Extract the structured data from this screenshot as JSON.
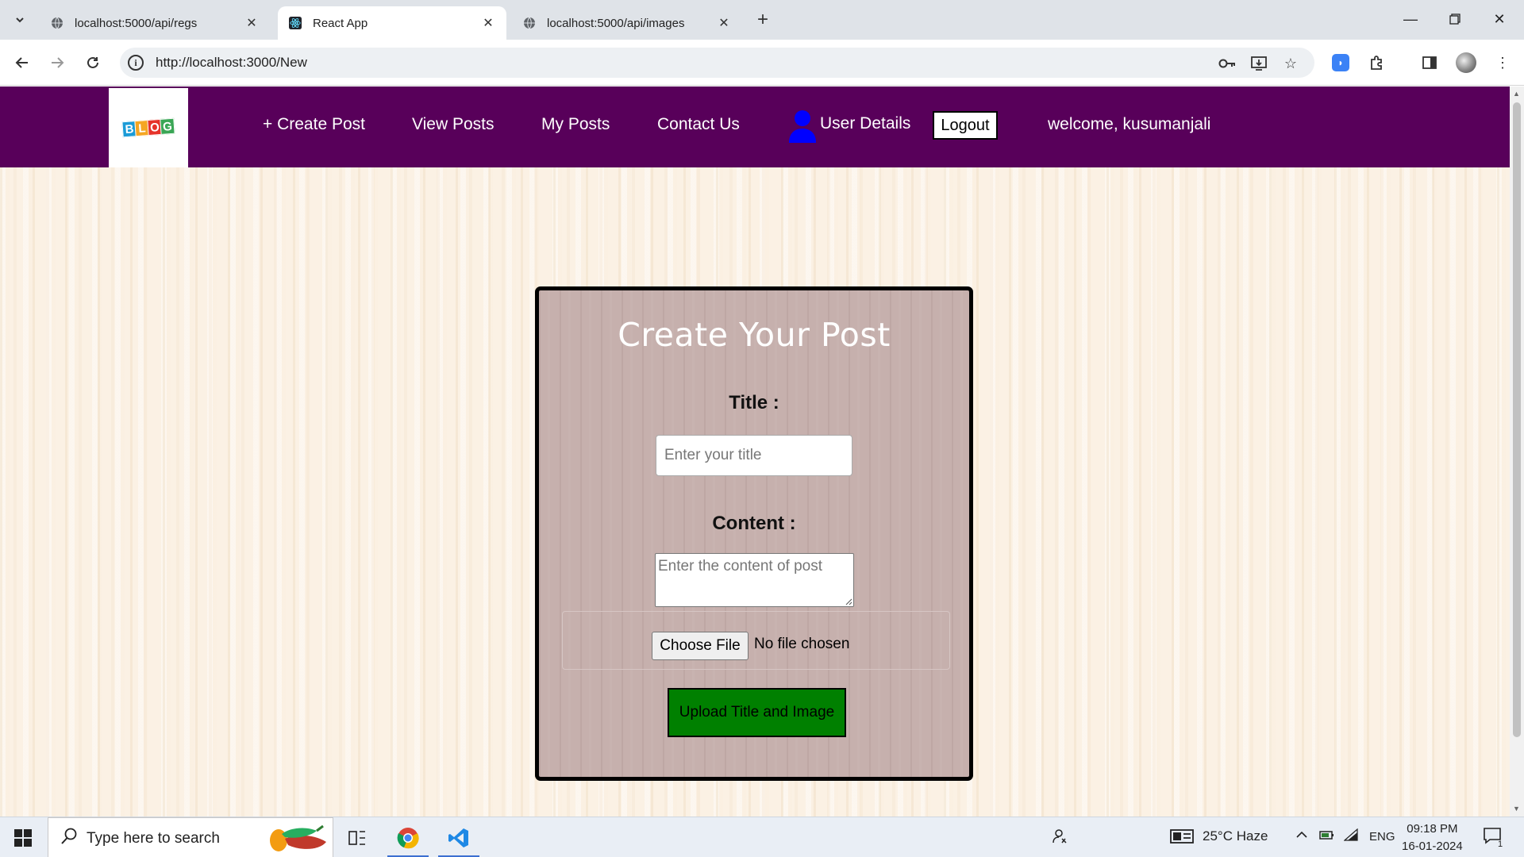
{
  "browser": {
    "tabs": [
      {
        "title": "localhost:5000/api/regs",
        "active": false
      },
      {
        "title": "React App",
        "active": true
      },
      {
        "title": "localhost:5000/api/images",
        "active": false
      }
    ],
    "new_tab_label": "+",
    "url": "http://localhost:3000/New"
  },
  "navbar": {
    "logo_letters": [
      "B",
      "L",
      "O",
      "G"
    ],
    "logo_colors": [
      "#1a9bd7",
      "#f5a623",
      "#e6332a",
      "#3aa655"
    ],
    "background": "#58005a",
    "links": {
      "create_post": "+ Create Post",
      "view_posts": "View Posts",
      "my_posts": "My Posts",
      "contact_us": "Contact Us",
      "user_details": "User Details"
    },
    "logout_label": "Logout",
    "welcome_text": "welcome, kusumanjali"
  },
  "form": {
    "heading": "Create Your Post",
    "title_label": "Title :",
    "title_placeholder": "Enter your title",
    "content_label": "Content :",
    "content_placeholder": "Enter the content of post",
    "file_button_label": "Choose File",
    "file_status": "No file chosen",
    "submit_label": "Upload Title and Image",
    "submit_color": "#008000"
  },
  "taskbar": {
    "search_placeholder": "Type here to search",
    "weather": "25°C  Haze",
    "language": "ENG",
    "time": "09:18 PM",
    "date": "16-01-2024",
    "notification_count": "1"
  }
}
